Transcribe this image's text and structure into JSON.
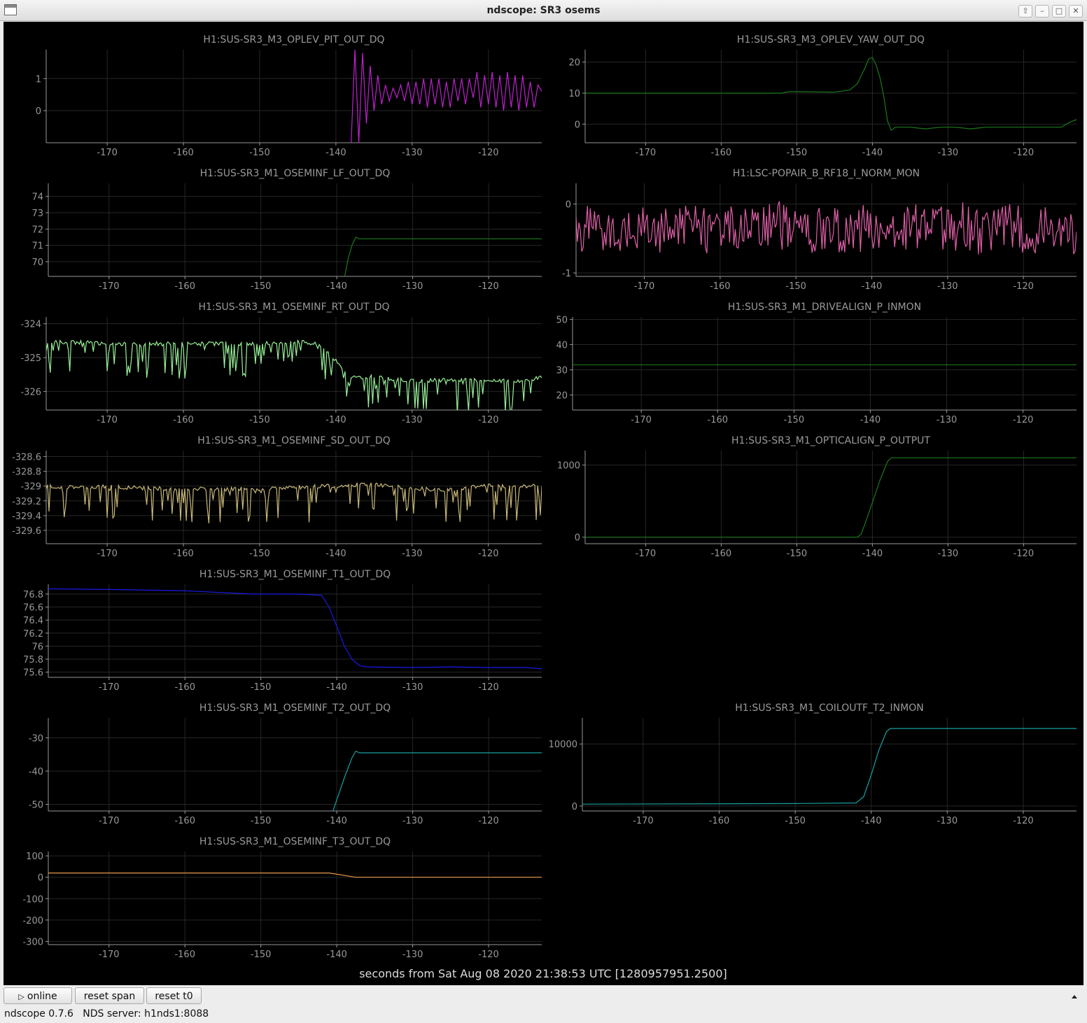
{
  "window": {
    "title": "ndscope: SR3 osems"
  },
  "axis_caption": "seconds from Sat Aug 08 2020 21:38:53 UTC [1280957951.2500]",
  "toolbar": {
    "online_label": "online",
    "reset_span_label": "reset span",
    "reset_t0_label": "reset t0"
  },
  "status": {
    "version": "ndscope 0.7.6",
    "server": "NDS server: h1nds1:8088"
  },
  "colors": {
    "background": "#000000",
    "axis": "#999999",
    "grid": "#262626"
  },
  "icons": {
    "online": "play-icon",
    "collapse": "chevron-up-icon"
  },
  "chart_data": [
    {
      "type": "line",
      "title": "H1:SUS-SR3_M3_OPLEV_PIT_OUT_DQ",
      "color": "#c020d0",
      "xlim": [
        -178,
        -113
      ],
      "ylim": [
        -1,
        1.9
      ],
      "xticks": [
        -170,
        -160,
        -150,
        -140,
        -130,
        -120
      ],
      "yticks": [
        {
          "v": 0,
          "t": "0"
        },
        {
          "v": 1,
          "t": "1"
        }
      ],
      "series": [
        {
          "x": [
            -138,
            -137.5,
            -137,
            -136.5,
            -136,
            -135.5,
            -135,
            -134.5,
            -134,
            -133.5,
            -133,
            -132.5,
            -132,
            -131.5,
            -131,
            -130.5,
            -130,
            -129.5,
            -129,
            -128.5,
            -128,
            -127.5,
            -127,
            -126.5,
            -126,
            -125.5,
            -125,
            -124.5,
            -124,
            -123.5,
            -123,
            -122.5,
            -122,
            -121.5,
            -121,
            -120.5,
            -120,
            -119.5,
            -119,
            -118.5,
            -118,
            -117.5,
            -117,
            -116.5,
            -116,
            -115.5,
            -115,
            -114.5,
            -114,
            -113.5,
            -113
          ],
          "y": [
            -1,
            1.9,
            -1,
            1.8,
            -0.4,
            1.4,
            0,
            1.1,
            0.2,
            0.8,
            0.3,
            0.7,
            0.4,
            0.8,
            0.3,
            0.9,
            0.2,
            0.9,
            0.2,
            1,
            0.1,
            1,
            0.2,
            1,
            0.1,
            0.9,
            0.1,
            1,
            0.3,
            1,
            0.2,
            1,
            0.4,
            1.2,
            0.1,
            1.1,
            0.2,
            1.2,
            0.1,
            1.1,
            0,
            1.2,
            0.1,
            1.1,
            0,
            1.1,
            0.1,
            0.9,
            0.1,
            0.8,
            0.6
          ]
        }
      ]
    },
    {
      "type": "line",
      "title": "H1:SUS-SR3_M3_OPLEV_YAW_OUT_DQ",
      "color": "#1a7a1a",
      "xlim": [
        -178,
        -113
      ],
      "ylim": [
        -6,
        24
      ],
      "xticks": [
        -170,
        -160,
        -150,
        -140,
        -130,
        -120
      ],
      "yticks": [
        {
          "v": 0,
          "t": "0"
        },
        {
          "v": 10,
          "t": "10"
        },
        {
          "v": 20,
          "t": "20"
        }
      ],
      "series": [
        {
          "x": [
            -178,
            -170,
            -160,
            -152,
            -151,
            -145,
            -143,
            -142,
            -141,
            -140.5,
            -140,
            -139.5,
            -139,
            -138.5,
            -138,
            -137.5,
            -137,
            -135,
            -133,
            -131,
            -129,
            -127,
            -125,
            -123,
            -121,
            -119,
            -117,
            -115,
            -114,
            -113
          ],
          "y": [
            10,
            10,
            10,
            10,
            10.5,
            10.3,
            11,
            13,
            18,
            21,
            21.5,
            19,
            15,
            9,
            1,
            -2,
            -1,
            -1,
            -1.5,
            -1,
            -1,
            -1.5,
            -1,
            -1,
            -1,
            -1,
            -1,
            -1,
            0.5,
            1.5
          ]
        }
      ]
    },
    {
      "type": "line",
      "title": "H1:SUS-SR3_M1_OSEMINF_LF_OUT_DQ",
      "color": "#1a7a1a",
      "xlim": [
        -178,
        -113
      ],
      "ylim": [
        69.1,
        74.8
      ],
      "xticks": [
        -170,
        -160,
        -150,
        -140,
        -130,
        -120
      ],
      "yticks": [
        {
          "v": 70,
          "t": "70"
        },
        {
          "v": 71,
          "t": "71"
        },
        {
          "v": 72,
          "t": "72"
        },
        {
          "v": 73,
          "t": "73"
        },
        {
          "v": 74,
          "t": "74"
        }
      ],
      "series": [
        {
          "x": [
            -139,
            -138.5,
            -138,
            -137.5,
            -137,
            -135,
            -130,
            -125,
            -120,
            -115,
            -113
          ],
          "y": [
            69,
            70.2,
            71,
            71.5,
            71.4,
            71.4,
            71.4,
            71.4,
            71.4,
            71.4,
            71.4
          ]
        }
      ]
    },
    {
      "type": "line",
      "title": "H1:LSC-POPAIR_B_RF18_I_NORM_MON",
      "color": "#e060a8",
      "xlim": [
        -179,
        -113
      ],
      "ylim": [
        -1.05,
        0.3
      ],
      "xticks": [
        -170,
        -160,
        -150,
        -140,
        -130,
        -120
      ],
      "yticks": [
        {
          "v": -1,
          "t": "-1"
        },
        {
          "v": 0,
          "t": "0"
        }
      ],
      "series": [
        {
          "x": [
            -179,
            -176,
            -173,
            -170,
            -167,
            -164,
            -161,
            -158,
            -155,
            -152,
            -149,
            -146,
            -143,
            -140,
            -137,
            -134,
            -131,
            -128,
            -125,
            -122,
            -119,
            -116,
            -113
          ],
          "y": [
            -0.4,
            -0.3,
            -0.5,
            -0.35,
            -0.4,
            -0.3,
            -0.45,
            -0.35,
            -0.4,
            -0.3,
            -0.45,
            -0.35,
            -0.4,
            -0.3,
            -0.45,
            -0.35,
            -0.4,
            -0.3,
            -0.45,
            -0.35,
            -0.4,
            -0.3,
            -0.4
          ]
        }
      ]
    },
    {
      "type": "line",
      "title": "H1:SUS-SR3_M1_OSEMINF_RT_OUT_DQ",
      "color": "#98f098",
      "xlim": [
        -178,
        -113
      ],
      "ylim": [
        -326.55,
        -323.8
      ],
      "xticks": [
        -170,
        -160,
        -150,
        -140,
        -130,
        -120
      ],
      "yticks": [
        {
          "v": -326,
          "t": "-326"
        },
        {
          "v": -325,
          "t": "-325"
        },
        {
          "v": -324,
          "t": "-324"
        }
      ],
      "series": [
        {
          "x": [
            -178,
            -170,
            -160,
            -150,
            -145,
            -142,
            -141,
            -140,
            -139,
            -138,
            -137,
            -135,
            -130,
            -125,
            -120,
            -115,
            -113
          ],
          "y": [
            -324.55,
            -324.6,
            -324.62,
            -324.6,
            -324.55,
            -324.65,
            -324.85,
            -325.1,
            -325.45,
            -325.6,
            -325.6,
            -325.58,
            -325.72,
            -325.68,
            -325.7,
            -325.7,
            -325.6
          ]
        }
      ]
    },
    {
      "type": "line",
      "title": "H1:SUS-SR3_M1_DRIVEALIGN_P_INMON",
      "color": "#1a7a1a",
      "xlim": [
        -179,
        -113
      ],
      "ylim": [
        14,
        51
      ],
      "xticks": [
        -170,
        -160,
        -150,
        -140,
        -130,
        -120
      ],
      "yticks": [
        {
          "v": 20,
          "t": "20"
        },
        {
          "v": 30,
          "t": "30"
        },
        {
          "v": 40,
          "t": "40"
        },
        {
          "v": 50,
          "t": "50"
        }
      ],
      "series": [
        {
          "x": [
            -179,
            -113
          ],
          "y": [
            32,
            32
          ]
        }
      ]
    },
    {
      "type": "line",
      "title": "H1:SUS-SR3_M1_OSEMINF_SD_OUT_DQ",
      "color": "#c8b878",
      "xlim": [
        -178,
        -113
      ],
      "ylim": [
        -329.78,
        -328.52
      ],
      "xticks": [
        -170,
        -160,
        -150,
        -140,
        -130,
        -120
      ],
      "yticks": [
        {
          "v": -329.6,
          "t": "-329.6"
        },
        {
          "v": -329.4,
          "t": "-329.4"
        },
        {
          "v": -329.2,
          "t": "-329.2"
        },
        {
          "v": -329,
          "t": "-329"
        },
        {
          "v": -328.8,
          "t": "-328.8"
        },
        {
          "v": -328.6,
          "t": "-328.6"
        }
      ],
      "series": [
        {
          "x": [
            -178,
            -170,
            -160,
            -150,
            -140,
            -135,
            -130,
            -125,
            -120,
            -115,
            -113
          ],
          "y": [
            -329.02,
            -329.02,
            -329.05,
            -329.05,
            -329.0,
            -328.98,
            -329.05,
            -329.05,
            -329.0,
            -329.02,
            -329.0
          ]
        }
      ]
    },
    {
      "type": "line",
      "title": "H1:SUS-SR3_M1_OPTICALIGN_P_OUTPUT",
      "color": "#1a7a1a",
      "xlim": [
        -178,
        -113
      ],
      "ylim": [
        -90,
        1200
      ],
      "xticks": [
        -170,
        -160,
        -150,
        -140,
        -130,
        -120
      ],
      "yticks": [
        {
          "v": 0,
          "t": "0"
        },
        {
          "v": 1000,
          "t": "1000"
        }
      ],
      "series": [
        {
          "x": [
            -178,
            -142,
            -141.5,
            -141,
            -140,
            -139,
            -138,
            -137.5,
            -113
          ],
          "y": [
            0,
            0,
            40,
            180,
            480,
            790,
            1050,
            1100,
            1100
          ]
        }
      ]
    },
    {
      "type": "line",
      "title": "H1:SUS-SR3_M1_OSEMINF_T1_OUT_DQ",
      "color": "#1a1ae8",
      "xlim": [
        -178,
        -113
      ],
      "ylim": [
        75.52,
        76.95
      ],
      "xticks": [
        -170,
        -160,
        -150,
        -140,
        -130,
        -120
      ],
      "yticks": [
        {
          "v": 75.6,
          "t": "75.6"
        },
        {
          "v": 75.8,
          "t": "75.8"
        },
        {
          "v": 76,
          "t": "76"
        },
        {
          "v": 76.2,
          "t": "76.2"
        },
        {
          "v": 76.4,
          "t": "76.4"
        },
        {
          "v": 76.6,
          "t": "76.6"
        },
        {
          "v": 76.8,
          "t": "76.8"
        }
      ],
      "series": [
        {
          "x": [
            -178,
            -170,
            -160,
            -151,
            -145,
            -142,
            -141,
            -140,
            -139,
            -138,
            -137,
            -136,
            -130,
            -125,
            -120,
            -115,
            -113
          ],
          "y": [
            76.88,
            76.87,
            76.85,
            76.8,
            76.8,
            76.78,
            76.6,
            76.3,
            76.0,
            75.8,
            75.7,
            75.68,
            75.67,
            75.68,
            75.67,
            75.67,
            75.65
          ]
        }
      ]
    },
    {
      "type": "line",
      "title": "H1:SUS-SR3_M1_OSEMINF_T2_OUT_DQ",
      "color": "#18a0a0",
      "xlim": [
        -178,
        -113
      ],
      "ylim": [
        -52,
        -24
      ],
      "xticks": [
        -170,
        -160,
        -150,
        -140,
        -130,
        -120
      ],
      "yticks": [
        {
          "v": -50,
          "t": "-50"
        },
        {
          "v": -40,
          "t": "-40"
        },
        {
          "v": -30,
          "t": "-30"
        }
      ],
      "series": [
        {
          "x": [
            -140.5,
            -139,
            -138,
            -137.5,
            -137,
            -130,
            -120,
            -113
          ],
          "y": [
            -52,
            -42,
            -36,
            -34,
            -34.5,
            -34.5,
            -34.5,
            -34.5
          ]
        }
      ]
    },
    {
      "type": "line",
      "title": "H1:SUS-SR3_M1_COILOUTF_T2_INMON",
      "color": "#18a0a0",
      "xlim": [
        -178,
        -113
      ],
      "ylim": [
        -800,
        14200
      ],
      "xticks": [
        -170,
        -160,
        -150,
        -140,
        -130,
        -120
      ],
      "yticks": [
        {
          "v": 0,
          "t": "0"
        },
        {
          "v": 10000,
          "t": "10000"
        }
      ],
      "series": [
        {
          "x": [
            -178,
            -150,
            -142,
            -141,
            -140,
            -139,
            -138,
            -137.5,
            -113
          ],
          "y": [
            300,
            400,
            500,
            1500,
            5000,
            9000,
            12000,
            12500,
            12500
          ]
        }
      ]
    },
    {
      "type": "line",
      "title": "H1:SUS-SR3_M1_OSEMINF_T3_OUT_DQ",
      "color": "#e89848",
      "xlim": [
        -178,
        -113
      ],
      "ylim": [
        -315,
        120
      ],
      "xticks": [
        -170,
        -160,
        -150,
        -140,
        -130,
        -120
      ],
      "yticks": [
        {
          "v": -300,
          "t": "-300"
        },
        {
          "v": -200,
          "t": "-200"
        },
        {
          "v": -100,
          "t": "-100"
        },
        {
          "v": 0,
          "t": "0"
        },
        {
          "v": 100,
          "t": "100"
        }
      ],
      "series": [
        {
          "x": [
            -178,
            -141,
            -137.5,
            -113
          ],
          "y": [
            20,
            20,
            0,
            0
          ]
        }
      ]
    }
  ]
}
